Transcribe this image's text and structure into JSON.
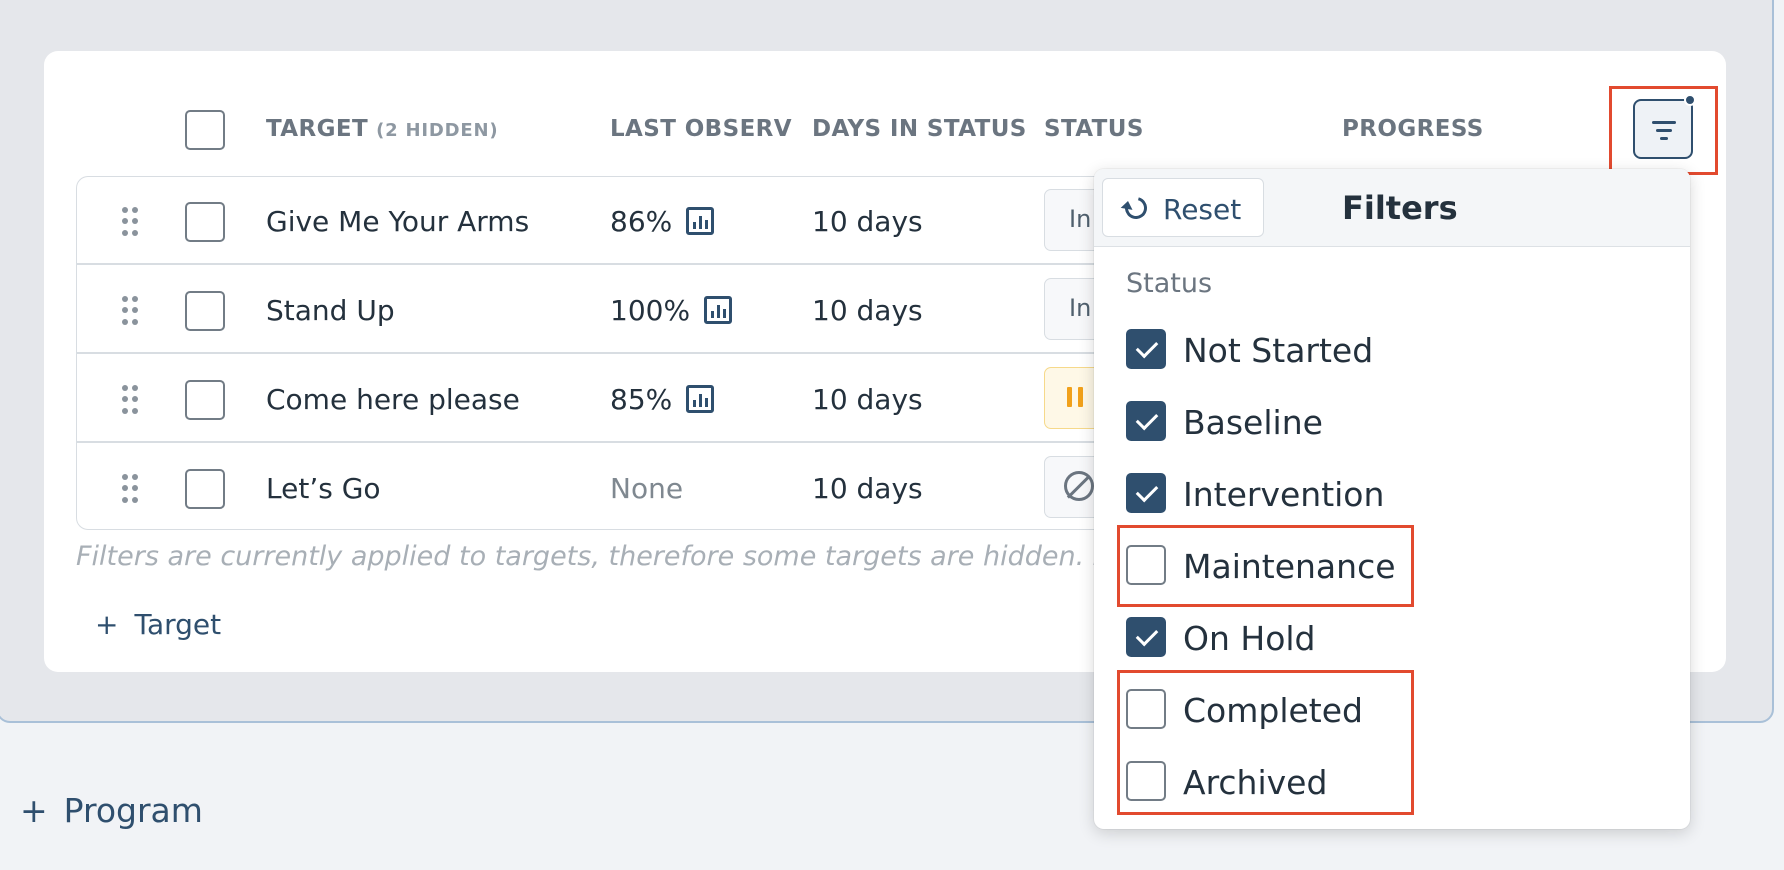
{
  "table": {
    "columns": {
      "target": "TARGET",
      "target_hidden": "(2 HIDDEN)",
      "last_observation": "LAST OBSERV",
      "days_in_status": "DAYS IN STATUS",
      "status": "STATUS",
      "progress": "PROGRESS"
    },
    "rows": [
      {
        "name": "Give Me Your Arms",
        "last_obs": "86%",
        "days": "10 days",
        "status_text": "In"
      },
      {
        "name": "Stand Up",
        "last_obs": "100%",
        "days": "10 days",
        "status_text": "In"
      },
      {
        "name": "Come here please",
        "last_obs": "85%",
        "days": "10 days",
        "status_icon": "pause-icon"
      },
      {
        "name": "Let’s Go",
        "last_obs": "None",
        "days": "10 days",
        "status_icon": "ban-icon"
      }
    ],
    "filter_note": "Filters are currently applied to targets, therefore some targets are hidden. Enab",
    "add_target_label": "Target"
  },
  "add_program_label": "Program",
  "filters": {
    "reset_label": "Reset",
    "title": "Filters",
    "section_label": "Status",
    "options": [
      {
        "label": "Not Started",
        "checked": true
      },
      {
        "label": "Baseline",
        "checked": true
      },
      {
        "label": "Intervention",
        "checked": true
      },
      {
        "label": "Maintenance",
        "checked": false
      },
      {
        "label": "On Hold",
        "checked": true
      },
      {
        "label": "Completed",
        "checked": false
      },
      {
        "label": "Archived",
        "checked": false
      }
    ]
  },
  "colors": {
    "accent": "#2f4f6e",
    "highlight": "#e24a2f",
    "on_hold": "#f1a11b"
  }
}
